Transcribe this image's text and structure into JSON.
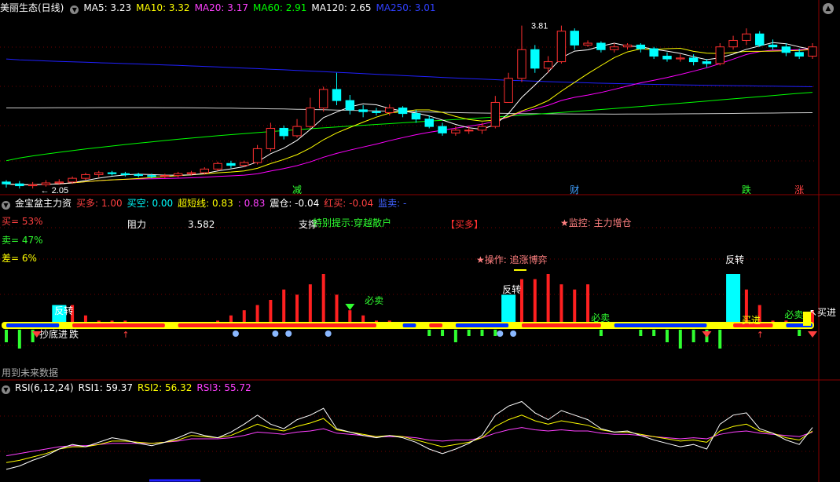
{
  "title": "美丽生态(日线)",
  "colors": {
    "up": "#ff3030",
    "down": "#00ffff",
    "ma5": "#ffffff",
    "ma10": "#ffff00",
    "ma20": "#ff00ff",
    "ma60": "#00ff00",
    "ma120": "#ffffff",
    "ma250": "#2020ff"
  },
  "ma_legend": [
    {
      "label": "MA5: 3.23",
      "color": "#ffffff"
    },
    {
      "label": "MA10: 3.32",
      "color": "#ffff00"
    },
    {
      "label": "MA20: 3.17",
      "color": "#ff40ff"
    },
    {
      "label": "MA60: 2.91",
      "color": "#00ff00"
    },
    {
      "label": "MA120: 2.65",
      "color": "#ffffff"
    },
    {
      "label": "MA250: 3.01",
      "color": "#3040ff"
    }
  ],
  "price_high_label": "3.81",
  "price_low_label": "2.05",
  "markers": [
    {
      "text": "减",
      "color": "#30ff30",
      "xi": 22
    },
    {
      "text": "财",
      "color": "#40a0ff",
      "xi": 43
    },
    {
      "text": "跌",
      "color": "#30ff30",
      "xi": 56
    },
    {
      "text": "涨",
      "color": "#ff4040",
      "xi": 60
    }
  ],
  "indicator": {
    "name": "金宝盆主力资",
    "legend": [
      {
        "label": "买多: 1.00",
        "color": "#ff4040"
      },
      {
        "label": "买空: 0.00",
        "color": "#00ffff"
      },
      {
        "label": "超短线: 0.83",
        "color": "#ffff00"
      },
      {
        "label": ": 0.83",
        "color": "#ff40ff"
      },
      {
        "label": "震仓: -0.04",
        "color": "#ffffff"
      },
      {
        "label": "红买: -0.04",
        "color": "#ff4040"
      },
      {
        "label": "监卖: -",
        "color": "#4060ff"
      }
    ],
    "buy_pct": "买= 53%",
    "sell_pct": "卖= 47%",
    "diff_pct": "差= 6%",
    "resistance_label": "阻力",
    "resistance_value": "3.582",
    "support_label": "支撑",
    "special_tip": "特别提示:穿越散户",
    "buy_signal": "【买多】",
    "monitor": "★监控: 主力增仓",
    "operate": "★操作: 追涨博弈",
    "future_note": "用到未来数据",
    "labels": {
      "reverse": "反转",
      "sell": "必卖",
      "buy": "买进",
      "bottom": "抄底进",
      "low": "跌"
    }
  },
  "rsi": {
    "name": "RSI(6,12,24)",
    "rsi1": "RSI1: 59.37",
    "rsi2": "RSI2: 56.32",
    "rsi3": "RSI3: 55.72"
  },
  "chart_data": {
    "type": "candlestick",
    "title": "美丽生态(日线)",
    "count": 62,
    "price_axis": [
      2.0,
      3.9
    ],
    "ohlc": [
      [
        2.12,
        2.1,
        2.14,
        2.06
      ],
      [
        2.1,
        2.08,
        2.13,
        2.05
      ],
      [
        2.08,
        2.09,
        2.12,
        2.05
      ],
      [
        2.09,
        2.11,
        2.14,
        2.07
      ],
      [
        2.11,
        2.12,
        2.15,
        2.09
      ],
      [
        2.12,
        2.16,
        2.18,
        2.1
      ],
      [
        2.16,
        2.2,
        2.22,
        2.14
      ],
      [
        2.2,
        2.22,
        2.24,
        2.17
      ],
      [
        2.22,
        2.21,
        2.24,
        2.19
      ],
      [
        2.21,
        2.2,
        2.23,
        2.18
      ],
      [
        2.2,
        2.19,
        2.22,
        2.17
      ],
      [
        2.19,
        2.18,
        2.21,
        2.16
      ],
      [
        2.18,
        2.19,
        2.21,
        2.16
      ],
      [
        2.19,
        2.21,
        2.23,
        2.17
      ],
      [
        2.21,
        2.22,
        2.24,
        2.19
      ],
      [
        2.22,
        2.26,
        2.28,
        2.2
      ],
      [
        2.26,
        2.32,
        2.34,
        2.24
      ],
      [
        2.32,
        2.3,
        2.35,
        2.27
      ],
      [
        2.3,
        2.33,
        2.35,
        2.28
      ],
      [
        2.33,
        2.48,
        2.52,
        2.31
      ],
      [
        2.48,
        2.7,
        2.76,
        2.45
      ],
      [
        2.7,
        2.62,
        2.73,
        2.58
      ],
      [
        2.62,
        2.72,
        2.8,
        2.6
      ],
      [
        2.72,
        2.92,
        3.03,
        2.7
      ],
      [
        2.92,
        3.12,
        3.15,
        2.88
      ],
      [
        3.12,
        3.0,
        3.3,
        2.95
      ],
      [
        3.0,
        2.9,
        3.06,
        2.85
      ],
      [
        2.9,
        2.88,
        2.95,
        2.82
      ],
      [
        2.88,
        2.87,
        2.92,
        2.84
      ],
      [
        2.87,
        2.92,
        2.96,
        2.84
      ],
      [
        2.92,
        2.86,
        2.94,
        2.82
      ],
      [
        2.86,
        2.8,
        2.9,
        2.76
      ],
      [
        2.8,
        2.72,
        2.84,
        2.7
      ],
      [
        2.72,
        2.65,
        2.76,
        2.62
      ],
      [
        2.65,
        2.68,
        2.72,
        2.62
      ],
      [
        2.68,
        2.68,
        2.72,
        2.64
      ],
      [
        2.68,
        2.72,
        2.76,
        2.64
      ],
      [
        2.72,
        2.98,
        3.05,
        2.7
      ],
      [
        2.98,
        3.24,
        3.3,
        3.12
      ],
      [
        3.24,
        3.55,
        3.81,
        3.2
      ],
      [
        3.55,
        3.35,
        3.6,
        3.3
      ],
      [
        3.35,
        3.42,
        3.48,
        3.3
      ],
      [
        3.42,
        3.75,
        3.81,
        3.4
      ],
      [
        3.75,
        3.6,
        3.78,
        3.55
      ],
      [
        3.6,
        3.62,
        3.65,
        3.58
      ],
      [
        3.62,
        3.55,
        3.64,
        3.52
      ],
      [
        3.55,
        3.58,
        3.62,
        3.52
      ],
      [
        3.58,
        3.6,
        3.62,
        3.55
      ],
      [
        3.6,
        3.56,
        3.62,
        3.52
      ],
      [
        3.56,
        3.48,
        3.58,
        3.45
      ],
      [
        3.48,
        3.45,
        3.52,
        3.42
      ],
      [
        3.45,
        3.46,
        3.5,
        3.42
      ],
      [
        3.46,
        3.42,
        3.5,
        3.38
      ],
      [
        3.42,
        3.4,
        3.45,
        3.36
      ],
      [
        3.4,
        3.58,
        3.62,
        3.38
      ],
      [
        3.58,
        3.65,
        3.7,
        3.55
      ],
      [
        3.65,
        3.72,
        3.78,
        3.6
      ],
      [
        3.72,
        3.6,
        3.75,
        3.58
      ],
      [
        3.6,
        3.58,
        3.66,
        3.55
      ],
      [
        3.58,
        3.52,
        3.62,
        3.48
      ],
      [
        3.52,
        3.48,
        3.56,
        3.45
      ],
      [
        3.48,
        3.58,
        3.62,
        3.45
      ]
    ],
    "indicator_bars": [
      -2,
      -3,
      -2,
      0,
      4,
      4,
      2,
      1,
      1,
      1,
      0,
      0,
      0,
      0,
      0,
      0,
      1,
      2,
      3,
      4,
      5,
      7,
      6,
      8,
      10,
      6,
      3,
      2,
      1,
      1,
      0,
      0,
      -1,
      -1,
      -2,
      -1,
      -1,
      -1,
      6,
      9,
      9,
      10,
      8,
      7,
      8,
      -1,
      0,
      0,
      -1,
      -1,
      -2,
      -3,
      -2,
      -2,
      -3,
      10,
      7,
      4,
      1,
      1,
      -1,
      3
    ],
    "rsi1": [
      22,
      25,
      30,
      34,
      40,
      44,
      42,
      46,
      50,
      48,
      45,
      43,
      46,
      50,
      55,
      52,
      50,
      55,
      62,
      70,
      62,
      58,
      66,
      70,
      76,
      58,
      55,
      52,
      50,
      52,
      50,
      46,
      40,
      36,
      40,
      45,
      52,
      70,
      78,
      82,
      72,
      66,
      74,
      70,
      66,
      58,
      55,
      56,
      52,
      48,
      45,
      42,
      44,
      40,
      62,
      70,
      72,
      58,
      54,
      48,
      44,
      59
    ],
    "rsi2": [
      28,
      30,
      33,
      36,
      40,
      42,
      42,
      44,
      47,
      47,
      46,
      45,
      46,
      48,
      52,
      51,
      50,
      52,
      57,
      62,
      58,
      56,
      60,
      63,
      67,
      57,
      55,
      53,
      51,
      52,
      51,
      48,
      45,
      42,
      44,
      46,
      50,
      60,
      66,
      70,
      65,
      62,
      65,
      63,
      61,
      57,
      55,
      55,
      53,
      51,
      49,
      47,
      48,
      46,
      56,
      60,
      62,
      56,
      54,
      50,
      48,
      56
    ],
    "rsi3": [
      34,
      36,
      38,
      40,
      42,
      43,
      43,
      44,
      45,
      45,
      45,
      45,
      46,
      47,
      49,
      49,
      49,
      50,
      52,
      55,
      54,
      53,
      55,
      56,
      58,
      54,
      53,
      52,
      51,
      51,
      51,
      50,
      48,
      47,
      48,
      48,
      50,
      54,
      57,
      59,
      57,
      56,
      57,
      56,
      56,
      54,
      53,
      53,
      52,
      51,
      50,
      49,
      50,
      49,
      53,
      55,
      56,
      54,
      53,
      52,
      51,
      55
    ]
  }
}
